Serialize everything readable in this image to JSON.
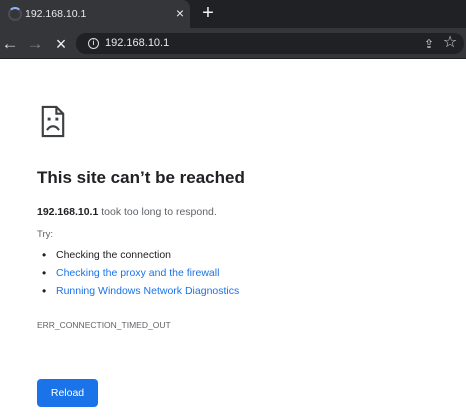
{
  "browser": {
    "tab_title": "192.168.10.1",
    "address": "192.168.10.1",
    "icons": {
      "loading": "loading-spinner-icon",
      "tab_close": "close-icon",
      "new_tab": "plus-icon",
      "back": "arrow-left-icon",
      "forward": "arrow-right-icon",
      "stop": "close-icon",
      "site_info": "info-icon",
      "share": "share-icon",
      "bookmark": "star-icon"
    },
    "colors": {
      "tab_strip": "#202124",
      "toolbar": "#35363a",
      "omnibox": "#202124"
    }
  },
  "page": {
    "icon": "sad-page-icon",
    "title": "This site can’t be reached",
    "host": "192.168.10.1",
    "summary_suffix": " took too long to respond.",
    "try_label": "Try:",
    "suggestions": [
      {
        "text": "Checking the connection",
        "link": false
      },
      {
        "text": "Checking the proxy and the firewall",
        "link": true
      },
      {
        "text": "Running Windows Network Diagnostics",
        "link": true
      }
    ],
    "error_code": "ERR_CONNECTION_TIMED_OUT",
    "reload_label": "Reload",
    "colors": {
      "background": "#ffffff",
      "text": "#202124",
      "secondary_text": "#5f6368",
      "link": "#1a73e8",
      "button": "#1a73e8"
    }
  }
}
